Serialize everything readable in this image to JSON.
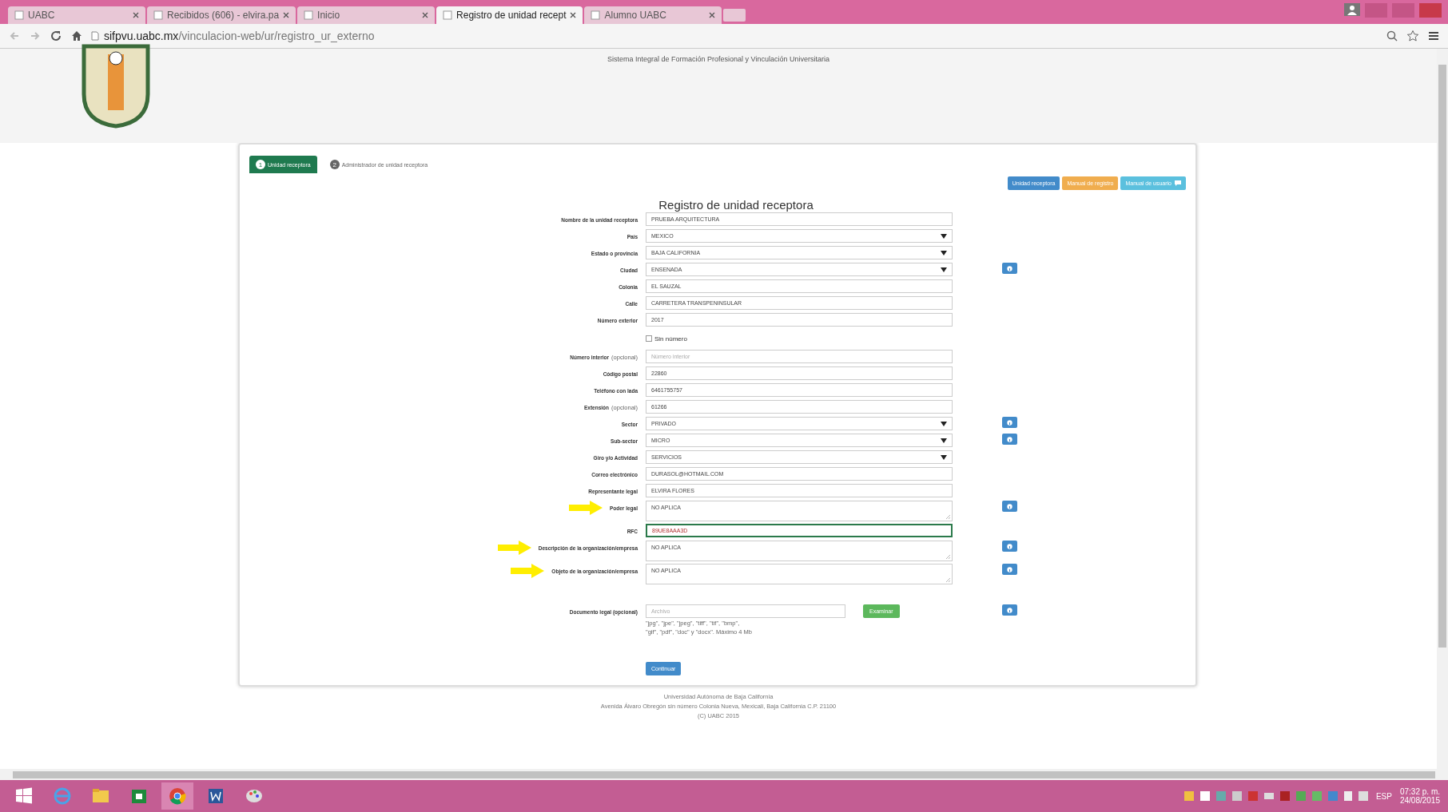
{
  "browser": {
    "tabs": [
      {
        "label": "UABC",
        "selected": false
      },
      {
        "label": "Recibidos (606) - elvira.pa",
        "selected": false
      },
      {
        "label": "Inicio",
        "selected": false
      },
      {
        "label": "Registro de unidad recept",
        "selected": true
      },
      {
        "label": "Alumno UABC",
        "selected": false
      }
    ],
    "url_host": "sifpvu.uabc.mx",
    "url_path": "/vinculacion-web/ur/registro_ur_externo"
  },
  "header": {
    "system_title": "Sistema Integral de Formación Profesional y Vinculación Universitaria"
  },
  "steps": [
    {
      "number": "1",
      "label": "Unidad receptora",
      "selected": true
    },
    {
      "number": "2",
      "label": "Administrador de unidad receptora",
      "selected": false
    }
  ],
  "actions": [
    {
      "label": "Unidad receptora",
      "kind": "primary"
    },
    {
      "label": "Manual de registro",
      "kind": "warning"
    },
    {
      "label": "Manual de usuario",
      "kind": "info"
    }
  ],
  "form": {
    "title": "Registro de unidad receptora",
    "fields": [
      {
        "kind": "text",
        "label": "Nombre de la unidad receptora",
        "value": "PRUEBA ARQUITECTURA"
      },
      {
        "kind": "select",
        "label": "País",
        "value": "MEXICO"
      },
      {
        "kind": "select",
        "label": "Estado o provincia",
        "value": "BAJA CALIFORNIA"
      },
      {
        "kind": "select",
        "label": "Ciudad",
        "value": "ENSENADA",
        "info_button": true
      },
      {
        "kind": "text",
        "label": "Colonia",
        "value": "EL SAUZAL"
      },
      {
        "kind": "text",
        "label": "Calle",
        "value": "CARRETERA TRANSPENINSULAR"
      },
      {
        "kind": "text",
        "label": "Número exterior",
        "value": "2017"
      },
      {
        "kind": "checkbox",
        "label": "Sin número",
        "checked": false
      },
      {
        "kind": "text",
        "label": "Número interior",
        "hint": "(opcional)",
        "placeholder": "Número interior"
      },
      {
        "kind": "text",
        "label": "Código postal",
        "value": "22860"
      },
      {
        "kind": "text",
        "label": "Teléfono con lada",
        "value": "6461755757"
      },
      {
        "kind": "text",
        "label": "Extensión",
        "hint": "(opcional)",
        "value": "61266"
      },
      {
        "kind": "select",
        "label": "Sector",
        "value": "PRIVADO",
        "info_button": true
      },
      {
        "kind": "select",
        "label": "Sub-sector",
        "value": "MICRO",
        "info_button": true
      },
      {
        "kind": "select",
        "label": "Giro y/o Actividad",
        "value": "SERVICIOS"
      },
      {
        "kind": "text",
        "label": "Correo electrónico",
        "value": "DURASOL@HOTMAIL.COM"
      },
      {
        "kind": "text",
        "label": "Representante legal",
        "value": "ELVIRA FLORES"
      },
      {
        "kind": "textarea",
        "label": "Poder legal",
        "value": "NO APLICA",
        "info_button": true,
        "arrow": true
      },
      {
        "kind": "text",
        "label": "RFC",
        "value": "89UE8AAA3D",
        "invalid": true
      },
      {
        "kind": "textarea",
        "label": "Descripción de la organización/empresa",
        "value": "NO APLICA",
        "info_button": true,
        "arrow": true
      },
      {
        "kind": "textarea",
        "label": "Objeto de la organización/empresa",
        "value": "NO APLICA",
        "info_button": true,
        "arrow": true
      },
      {
        "kind": "file",
        "label": "Documento legal (opcional)",
        "placeholder": "Archivo",
        "button": "Examinar",
        "info_button": true,
        "help": [
          "\"jpg\", \"jpe\", \"jpeg\", \"tiff\", \"tif\", \"bmp\",",
          "\"gif\", \"pdf\", \"doc\" y \"docx\". Máximo 4 Mb"
        ]
      }
    ],
    "submit": "Continuar"
  },
  "footer": [
    "Universidad Autónoma de Baja California",
    "Avenida Álvaro Obregón sin número Colonia Nueva, Mexicali, Baja California C.P. 21100",
    "(C) UABC 2015"
  ],
  "taskbar": {
    "language": "ESP",
    "time": "07:32 p. m.",
    "date": "24/08/2015"
  }
}
